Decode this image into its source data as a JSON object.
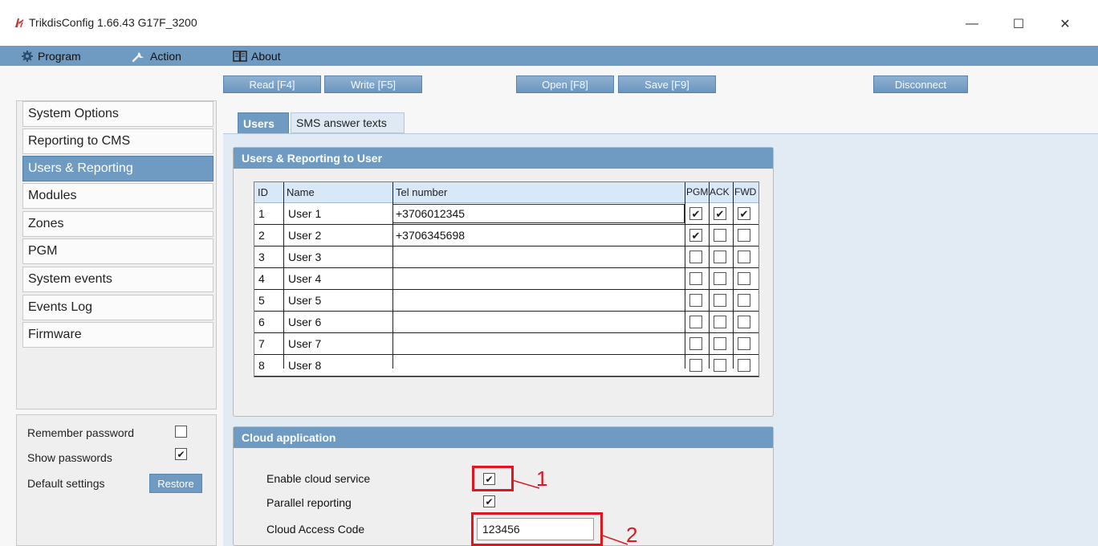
{
  "window": {
    "title": "TrikdisConfig 1.66.43   G17F_3200",
    "minimize_glyph": "—",
    "maximize_glyph": "☐",
    "close_glyph": "✕"
  },
  "menu": {
    "program": "Program",
    "action": "Action",
    "about": "About"
  },
  "toolbar": {
    "read": "Read [F4]",
    "write": "Write [F5]",
    "open": "Open [F8]",
    "save": "Save [F9]",
    "disconnect": "Disconnect"
  },
  "sidebar": {
    "items": [
      {
        "label": "System Options"
      },
      {
        "label": "Reporting to CMS"
      },
      {
        "label": "Users & Reporting"
      },
      {
        "label": "Modules"
      },
      {
        "label": "Zones"
      },
      {
        "label": "PGM"
      },
      {
        "label": "System events"
      },
      {
        "label": "Events Log"
      },
      {
        "label": "Firmware"
      }
    ],
    "active_index": 2
  },
  "options": {
    "remember_password": {
      "label": "Remember password",
      "checked": false
    },
    "show_passwords": {
      "label": "Show passwords",
      "checked": true
    },
    "default_settings": {
      "label": "Default settings",
      "button": "Restore"
    }
  },
  "tabs": {
    "users": "Users",
    "sms": "SMS answer texts"
  },
  "users_group": {
    "title": "Users & Reporting to User",
    "columns": {
      "id": "ID",
      "name": "Name",
      "tel": "Tel number",
      "pgm": "PGM",
      "ack": "ACK",
      "fwd": "FWD"
    },
    "rows": [
      {
        "id": "1",
        "name": "User 1",
        "tel": "+3706012345",
        "pgm": true,
        "ack": true,
        "fwd": true
      },
      {
        "id": "2",
        "name": "User 2",
        "tel": "+3706345698",
        "pgm": true,
        "ack": false,
        "fwd": false
      },
      {
        "id": "3",
        "name": "User 3",
        "tel": "",
        "pgm": false,
        "ack": false,
        "fwd": false
      },
      {
        "id": "4",
        "name": "User 4",
        "tel": "",
        "pgm": false,
        "ack": false,
        "fwd": false
      },
      {
        "id": "5",
        "name": "User 5",
        "tel": "",
        "pgm": false,
        "ack": false,
        "fwd": false
      },
      {
        "id": "6",
        "name": "User 6",
        "tel": "",
        "pgm": false,
        "ack": false,
        "fwd": false
      },
      {
        "id": "7",
        "name": "User 7",
        "tel": "",
        "pgm": false,
        "ack": false,
        "fwd": false
      },
      {
        "id": "8",
        "name": "User 8",
        "tel": "",
        "pgm": false,
        "ack": false,
        "fwd": false
      }
    ]
  },
  "cloud_group": {
    "title": "Cloud application",
    "enable_label": "Enable cloud service",
    "enable_checked": true,
    "parallel_label": "Parallel reporting",
    "parallel_checked": true,
    "access_code_label": "Cloud Access Code",
    "access_code_value": "123456"
  },
  "annotations": {
    "marker_1": "1",
    "marker_2": "2",
    "color": "#e0161e"
  },
  "colors": {
    "accent": "#6f9bc2",
    "panel": "#efefef",
    "content_bg": "#e2eaf3"
  },
  "icons": {
    "check": "✔"
  }
}
